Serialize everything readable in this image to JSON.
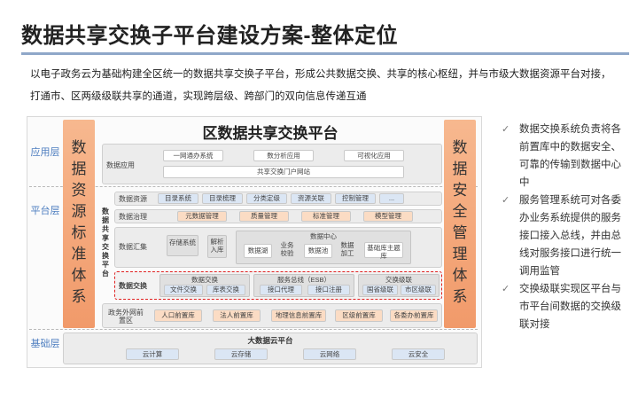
{
  "header": {
    "title": "数据共享交换子平台建设方案-整体定位",
    "intro": "以电子政务云为基础构建全区统一的数据共享交换子平台，形成公共数据交换、共享的核心枢纽，并与市级大数据资源平台对接，打通市、区两级级联共享的通道，实现跨层级、跨部门的双向信息传递互通"
  },
  "diagram": {
    "title": "区数据共享交换平台",
    "bands": {
      "app": "应用层",
      "platform": "平台层",
      "base": "基础层"
    },
    "left_bar": "数据资源标准体系",
    "right_bar": "数据安全管理体系",
    "vertical_label": "数据共享交换平台",
    "app_row": {
      "label": "数据应用",
      "items": [
        "一网通办系统",
        "数分析应用",
        "可视化应用"
      ],
      "portal": "共享交换门户网站"
    },
    "resource_row": {
      "label": "数据资源",
      "items": [
        "目录系统",
        "目录梳理",
        "分类定级",
        "资源关联",
        "控制管理",
        "..."
      ]
    },
    "governance_row": {
      "label": "数据治理",
      "items": [
        "元数据管理",
        "质量管理",
        "标准管理",
        "模型管理"
      ]
    },
    "collect_row": {
      "label": "数据汇集",
      "storage": "存储系统",
      "parse": "解析入库",
      "center_title": "数据中心",
      "lake": "数据湖",
      "business": "业务校验",
      "pool": "数据池",
      "process": "数据加工",
      "topic": "基础库主题库"
    },
    "exchange_row": {
      "label": "数据交换",
      "group1": {
        "title": "数据交换",
        "items": [
          "文件交换",
          "库表交换"
        ]
      },
      "group2": {
        "title": "服务总线（ESB）",
        "items": [
          "接口代理",
          "接口注册"
        ]
      },
      "group3": {
        "title": "交换级联",
        "items": [
          "国省级联",
          "市区级联"
        ]
      }
    },
    "gov_row": {
      "label": "政务外网前置区",
      "items": [
        "人口前置库",
        "法人前置库",
        "地理信息前置库",
        "区级前置库",
        "各委办前置库"
      ]
    },
    "cloud_row": {
      "title": "大数据云平台",
      "items": [
        "云计算",
        "云存储",
        "云网络",
        "云安全"
      ]
    }
  },
  "bullets": [
    "数据交换系统负责将各前置库中的数据安全、可靠的传输到数据中心中",
    "服务管理系统可对各委办业务系统提供的服务接口接入总线，并由总线对服务接口进行统一调用监管",
    "交换级联实现区平台与市平台间数据的交换级联对接"
  ],
  "colors": {
    "accent": "#4f7fc0",
    "rule": "#8fa7c9",
    "side_bar": "#f19a6a",
    "highlight": "#e02020"
  }
}
